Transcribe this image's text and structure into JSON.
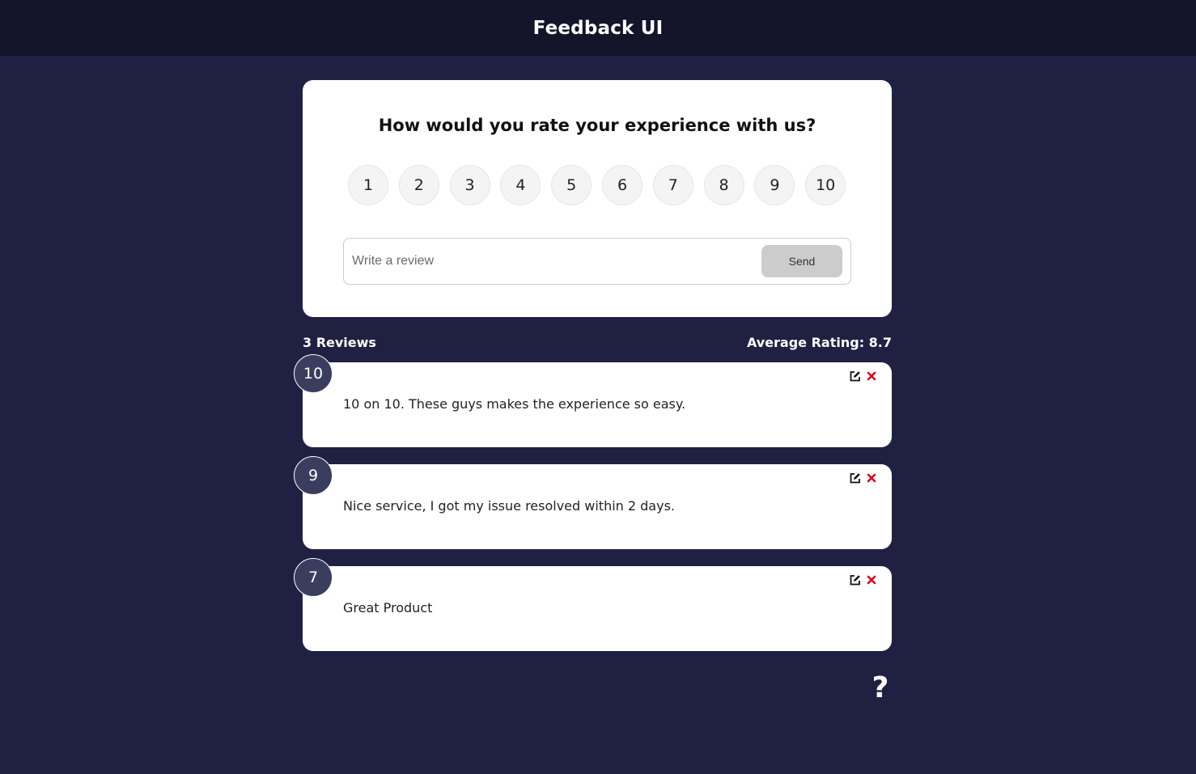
{
  "header": {
    "title": "Feedback UI"
  },
  "rating_card": {
    "question": "How would you rate your experience with us?",
    "options": [
      "1",
      "2",
      "3",
      "4",
      "5",
      "6",
      "7",
      "8",
      "9",
      "10"
    ],
    "input_placeholder": "Write a review",
    "send_label": "Send"
  },
  "stats": {
    "reviews_count": "3 Reviews",
    "average_rating": "Average Rating: 8.7"
  },
  "feedback": [
    {
      "rating": "10",
      "text": "10 on 10. These guys makes the experience so easy."
    },
    {
      "rating": "9",
      "text": "Nice service, I got my issue resolved within 2 days."
    },
    {
      "rating": "7",
      "text": "Great Product"
    }
  ],
  "help": {
    "symbol": "?"
  },
  "colors": {
    "background": "#202142",
    "header": "#14152b",
    "badge": "#3a3d5e",
    "delete": "#e0001b"
  }
}
